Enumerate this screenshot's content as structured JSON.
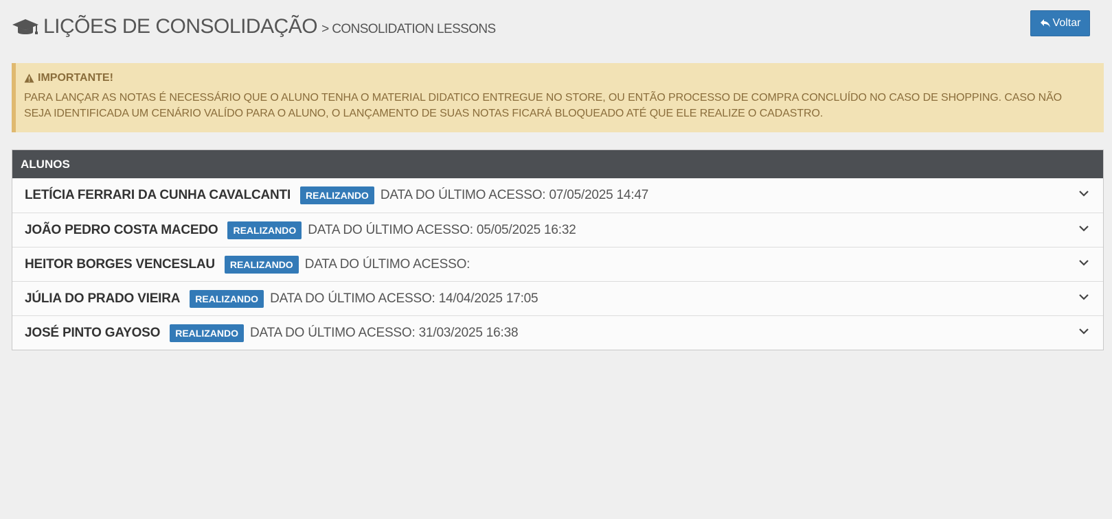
{
  "header": {
    "title": "LIÇÕES DE CONSOLIDAÇÃO",
    "subtitle": "> CONSOLIDATION LESSONS",
    "title_icon": "graduation-cap-icon",
    "back_button_label": "Voltar",
    "back_button_icon": "reply-arrow-icon"
  },
  "alert": {
    "icon": "warning-icon",
    "title": "IMPORTANTE!",
    "text": "PARA LANÇAR AS NOTAS É NECESSÁRIO QUE O ALUNO TENHA O MATERIAL DIDATICO ENTREGUE NO STORE, OU ENTÃO PROCESSO DE COMPRA CONCLUÍDO NO CASO DE SHOPPING. CASO NÃO SEJA IDENTIFICADA UM CENÁRIO VALÍDO PARA O ALUNO, O LANÇAMENTO DE SUAS NOTAS FICARÁ BLOQUEADO ATÉ QUE ELE REALIZE O CADASTRO.",
    "background": "#f2e2b5",
    "border_color": "#e0b970",
    "text_color": "#8a6d3b"
  },
  "students_panel": {
    "heading": "ALUNOS",
    "students": [
      {
        "name": "LETÍCIA FERRARI DA CUNHA CAVALCANTI",
        "status": "REALIZANDO",
        "last_access": "DATA DO ÚLTIMO ACESSO: 07/05/2025 14:47"
      },
      {
        "name": "JOÃO PEDRO COSTA MACEDO",
        "status": "REALIZANDO",
        "last_access": "DATA DO ÚLTIMO ACESSO: 05/05/2025 16:32"
      },
      {
        "name": "HEITOR BORGES VENCESLAU",
        "status": "REALIZANDO",
        "last_access": "DATA DO ÚLTIMO ACESSO:"
      },
      {
        "name": "JÚLIA DO PRADO VIEIRA",
        "status": "REALIZANDO",
        "last_access": "DATA DO ÚLTIMO ACESSO: 14/04/2025 17:05"
      },
      {
        "name": "JOSÉ PINTO GAYOSO",
        "status": "REALIZANDO",
        "last_access": "DATA DO ÚLTIMO ACESSO: 31/03/2025 16:38"
      }
    ]
  },
  "colors": {
    "primary": "#337ab7",
    "panel_heading": "#4c4f53",
    "background": "#efefef"
  }
}
